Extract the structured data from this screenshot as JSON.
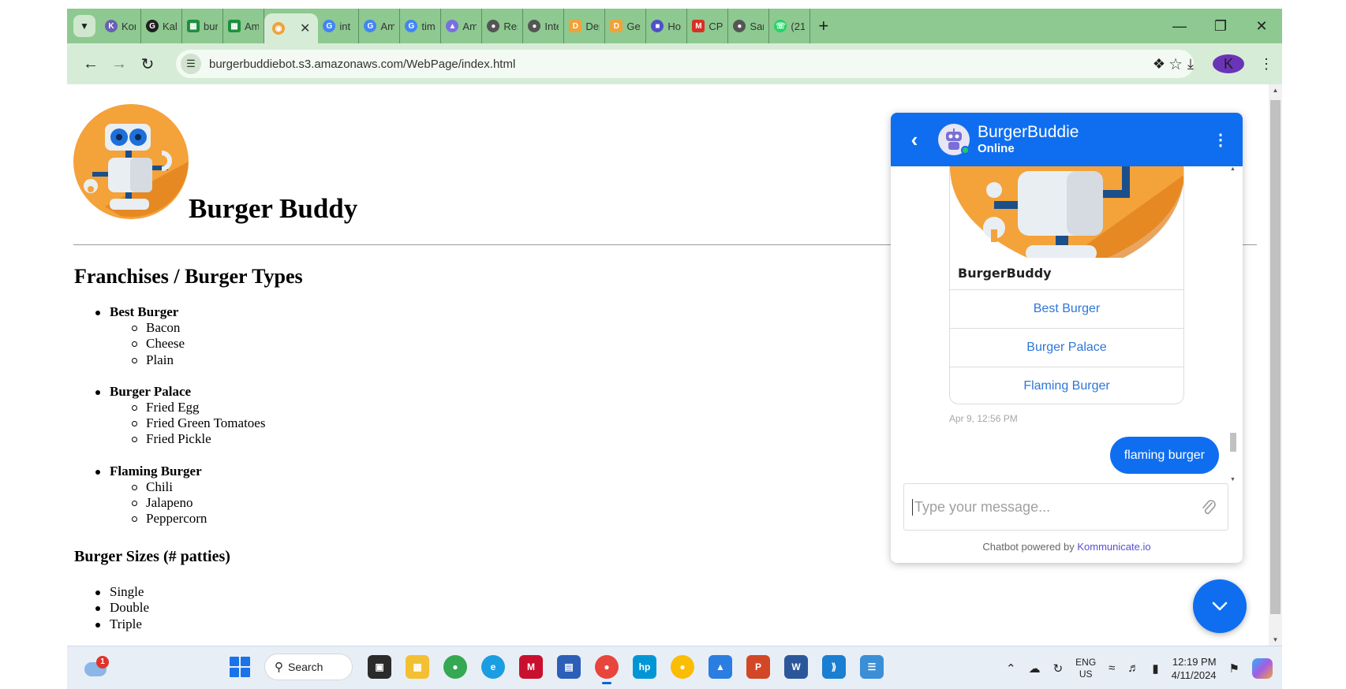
{
  "browser": {
    "tabs": [
      {
        "label": "Kon",
        "icon": "kommunicate-icon",
        "color": "#6b5fb5"
      },
      {
        "label": "Kal",
        "icon": "github-icon",
        "color": "#1f1f1f"
      },
      {
        "label": "bur",
        "icon": "sheet-icon",
        "color": "#1e8e3e"
      },
      {
        "label": "Am",
        "icon": "sheet-icon",
        "color": "#1e8e3e"
      },
      {
        "label": "int",
        "icon": "google-icon",
        "color": "#4285f4"
      },
      {
        "label": "Am",
        "icon": "google-icon",
        "color": "#4285f4"
      },
      {
        "label": "tim",
        "icon": "google-icon",
        "color": "#4285f4"
      },
      {
        "label": "Am",
        "icon": "cube-icon",
        "color": "#7a6fe0"
      },
      {
        "label": "Res",
        "icon": "globe-icon",
        "color": "#555555"
      },
      {
        "label": "Inte",
        "icon": "globe-icon",
        "color": "#555555"
      },
      {
        "label": "Dep",
        "icon": "doc-icon",
        "color": "#f0a23a"
      },
      {
        "label": "Get",
        "icon": "doc-icon",
        "color": "#f0a23a"
      },
      {
        "label": "Ho",
        "icon": "chat-icon",
        "color": "#5050c8"
      },
      {
        "label": "CPS",
        "icon": "gmail-icon",
        "color": "#d93025"
      },
      {
        "label": "San",
        "icon": "globe-icon",
        "color": "#555555"
      },
      {
        "label": "(21",
        "icon": "whatsapp-icon",
        "color": "#25d366"
      }
    ],
    "url": "burgerbuddiebot.s3.amazonaws.com/WebPage/index.html",
    "profile_initial": "K"
  },
  "page": {
    "title": "Burger Buddy",
    "franchises_heading": "Franchises / Burger Types",
    "franchises": [
      {
        "name": "Best Burger",
        "types": [
          "Bacon",
          "Cheese",
          "Plain"
        ]
      },
      {
        "name": "Burger Palace",
        "types": [
          "Fried Egg",
          "Fried Green Tomatoes",
          "Fried Pickle"
        ]
      },
      {
        "name": "Flaming Burger",
        "types": [
          "Chili",
          "Jalapeno",
          "Peppercorn"
        ]
      }
    ],
    "sizes_heading": "Burger Sizes (# patties)",
    "sizes": [
      "Single",
      "Double",
      "Triple"
    ]
  },
  "chat": {
    "bot_name": "BurgerBuddie",
    "status": "Online",
    "card_title": "BurgerBuddy",
    "card_options": [
      "Best Burger",
      "Burger Palace",
      "Flaming Burger"
    ],
    "timestamp": "Apr 9, 12:56 PM",
    "user_message": "flaming burger",
    "input_placeholder": "Type your message...",
    "powered_prefix": "Chatbot powered by",
    "powered_brand": "Kommunicate.io",
    "accent": "#0f6ef0"
  },
  "taskbar": {
    "search_label": "Search",
    "weather_badge": "1",
    "lang_line1": "ENG",
    "lang_line2": "US",
    "time": "12:19 PM",
    "date": "4/11/2024"
  }
}
